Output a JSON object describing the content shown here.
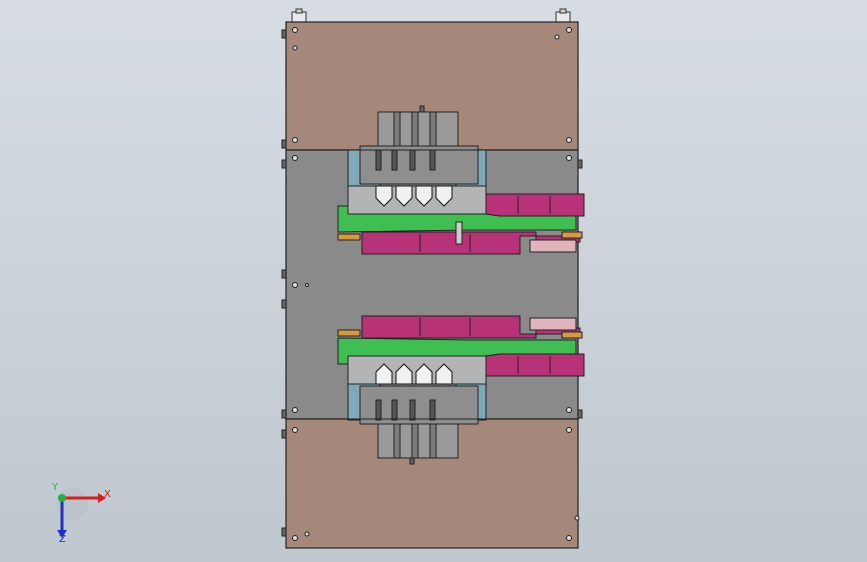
{
  "view": {
    "background_top": "#d7dde3",
    "background_bottom": "#bfc7cf"
  },
  "model": {
    "plate_color": "#a5887a",
    "base_color": "#8a8a8a",
    "steel_color": "#b2b4b6",
    "green_part_color": "#3fbf52",
    "magenta_part_color": "#b83278",
    "cyan_part_color": "#7fa9b8",
    "pink_part_color": "#e0b4bc",
    "orange_part_color": "#d89a3a"
  },
  "triad": {
    "x_label": "X",
    "y_label": "Y",
    "z_label": "Z",
    "x_color": "#d42020",
    "y_color": "#20b040",
    "z_color": "#2030c0"
  }
}
